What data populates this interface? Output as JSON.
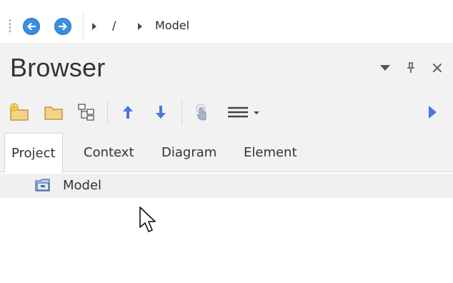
{
  "navbar": {
    "breadcrumb": [
      {
        "label": "/"
      },
      {
        "label": "Model"
      }
    ],
    "icons": {
      "back": "back-arrow-icon",
      "forward": "forward-arrow-icon"
    }
  },
  "panel": {
    "title": "Browser",
    "header_buttons": [
      {
        "icon": "dropdown-icon"
      },
      {
        "icon": "pin-icon",
        "glyph": "⊥"
      },
      {
        "icon": "close-icon",
        "glyph": "×"
      }
    ]
  },
  "toolbar": {
    "buttons": [
      {
        "icon": "new-package-icon"
      },
      {
        "icon": "folder-icon"
      },
      {
        "icon": "package-hierarchy-icon"
      },
      {
        "icon": "move-up-icon"
      },
      {
        "icon": "move-down-icon"
      },
      {
        "icon": "touch-hand-icon"
      },
      {
        "icon": "menu-lines-icon"
      },
      {
        "icon": "expand-right-icon"
      }
    ]
  },
  "tabs": [
    {
      "label": "Project",
      "active": true
    },
    {
      "label": "Context",
      "active": false
    },
    {
      "label": "Diagram",
      "active": false
    },
    {
      "label": "Element",
      "active": false
    }
  ],
  "tree": {
    "items": [
      {
        "label": "Model",
        "icon": "model-package-icon"
      }
    ]
  },
  "colors": {
    "nav_button": "#3b8de0",
    "arrow_blue": "#4a74e0",
    "panel_bg": "#f2f2f2",
    "folder_yellow": "#f4d389"
  }
}
